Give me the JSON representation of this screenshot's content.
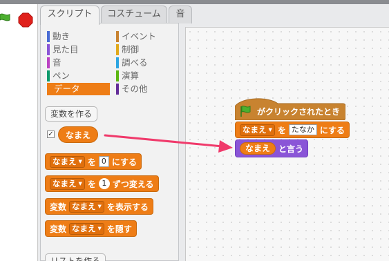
{
  "tabs": {
    "script": "スクリプト",
    "costume": "コスチューム",
    "sound": "音"
  },
  "categories": [
    {
      "label": "動き",
      "color": "#4a6cd4"
    },
    {
      "label": "見た目",
      "color": "#8a55d7"
    },
    {
      "label": "音",
      "color": "#bb42c3"
    },
    {
      "label": "ペン",
      "color": "#0e9a6c"
    },
    {
      "label": "データ",
      "color": "#ee7d16"
    },
    {
      "label": "イベント",
      "color": "#c88330"
    },
    {
      "label": "制御",
      "color": "#e1a91a"
    },
    {
      "label": "調べる",
      "color": "#2ca5e2"
    },
    {
      "label": "演算",
      "color": "#5cb712"
    },
    {
      "label": "その他",
      "color": "#632d99"
    }
  ],
  "palette": {
    "make_variable": "変数を作る",
    "variable_checkbox": "✓",
    "variable_name": "なまえ",
    "set_block": {
      "var": "なまえ",
      "to": "を",
      "value": "0",
      "suffix": "にする"
    },
    "change_block": {
      "var": "なまえ",
      "by": "を",
      "value": "1",
      "suffix": "ずつ変える"
    },
    "show_block": {
      "prefix": "変数",
      "var": "なまえ",
      "suffix": "を表示する"
    },
    "hide_block": {
      "prefix": "変数",
      "var": "なまえ",
      "suffix": "を隠す"
    },
    "make_list": "リストを作る"
  },
  "script": {
    "hat_label": "がクリックされたとき",
    "set_block": {
      "var": "なまえ",
      "to": "を",
      "value": "たなか",
      "suffix": "にする"
    },
    "say_block": {
      "reporter": "なまえ",
      "suffix": "と言う"
    }
  },
  "colors": {
    "data": "#ee7d16",
    "looks": "#8a55d7",
    "events": "#c88330",
    "flag": "#4caf2f",
    "stop": "#e0201b",
    "arrow": "#f03a6b"
  }
}
